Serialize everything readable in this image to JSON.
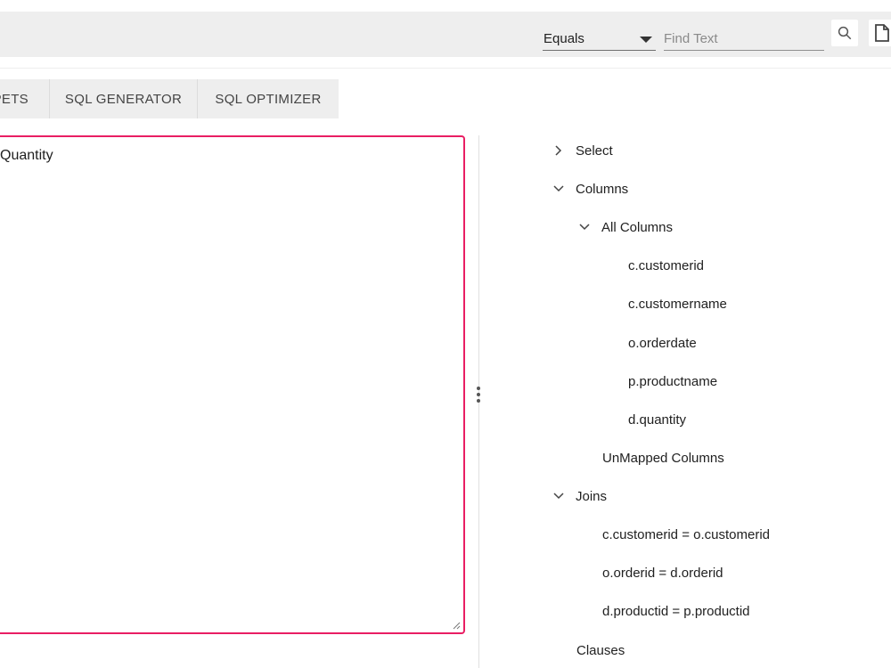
{
  "toolbar": {
    "filter_select_value": "Equals",
    "find_placeholder": "Find Text",
    "find_value": ""
  },
  "tabs": [
    {
      "label": "PETS"
    },
    {
      "label": "SQL GENERATOR"
    },
    {
      "label": "SQL OPTIMIZER"
    }
  ],
  "editor": {
    "text": "Quantity"
  },
  "tree": {
    "select": "Select",
    "columns": "Columns",
    "all_columns": "All Columns",
    "column_items": [
      "c.customerid",
      "c.customername",
      "o.orderdate",
      "p.productname",
      "d.quantity"
    ],
    "unmapped_columns": "UnMapped Columns",
    "joins": "Joins",
    "join_items": [
      "c.customerid = o.customerid",
      "o.orderid = d.orderid",
      "d.productid = p.productid"
    ],
    "clauses": "Clauses"
  },
  "colors": {
    "accent": "#e91e63",
    "toolbar_bg": "#eeeeee"
  }
}
